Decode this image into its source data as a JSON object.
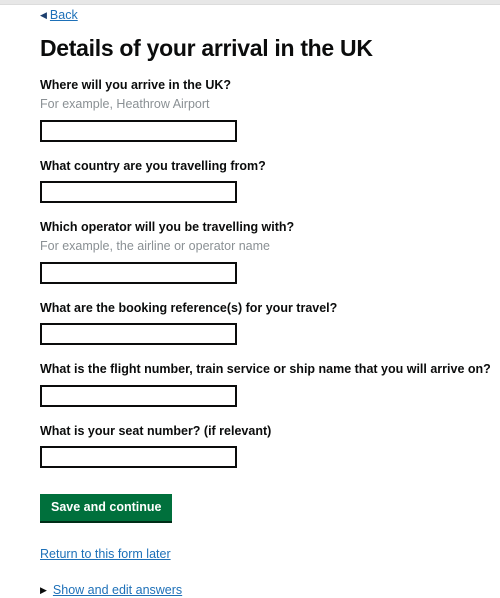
{
  "back": {
    "label": "Back",
    "arrow_icon": "triangle-left-icon"
  },
  "heading": "Details of your arrival in the UK",
  "fields": [
    {
      "label": "Where will you arrive in the UK?",
      "hint": "For example, Heathrow Airport",
      "value": "",
      "placeholder": ""
    },
    {
      "label": "What country are you travelling from?",
      "hint": "",
      "value": "",
      "placeholder": ""
    },
    {
      "label": "Which operator will you be travelling with?",
      "hint": "For example, the airline or operator name",
      "value": "",
      "placeholder": ""
    },
    {
      "label": "What are the booking reference(s) for your travel?",
      "hint": "",
      "value": "",
      "placeholder": ""
    },
    {
      "label": "What is the flight number, train service or ship name that you will arrive on?",
      "hint": "",
      "value": "",
      "placeholder": ""
    },
    {
      "label": "What is your seat number? (if relevant)",
      "hint": "",
      "value": "",
      "placeholder": ""
    }
  ],
  "actions": {
    "save_label": "Save and continue",
    "return_label": "Return to this form later",
    "details_label": "Show and edit answers",
    "details_arrow_icon": "triangle-right-icon"
  },
  "colors": {
    "button_green": "#00703c",
    "link_blue": "#1d70b8",
    "text_black": "#0b0c0c",
    "hint_grey": "#8a9094",
    "top_bar_grey": "#e7e7e7"
  }
}
